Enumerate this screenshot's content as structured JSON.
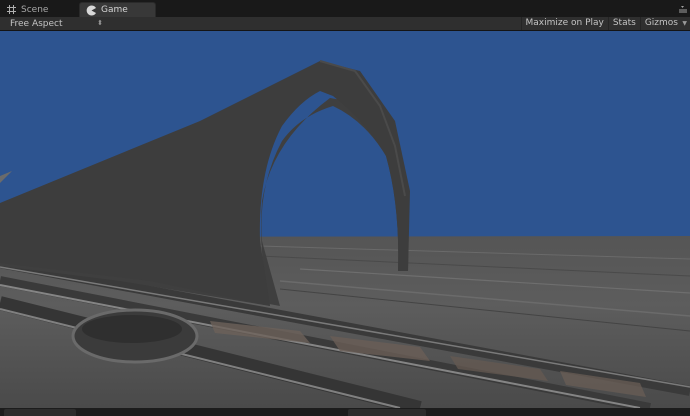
{
  "tabs": [
    {
      "label": "Scene",
      "icon": "grid-icon"
    },
    {
      "label": "Game",
      "icon": "pacman-icon"
    }
  ],
  "toolbar": {
    "aspect_label": "Free Aspect",
    "maximize_label": "Maximize on Play",
    "stats_label": "Stats",
    "gizmos_label": "Gizmos"
  },
  "colors": {
    "sky": "#2d5490",
    "ground": "#5a5a5a",
    "arch": "#3e3e3e",
    "tab_active": "#383838"
  }
}
